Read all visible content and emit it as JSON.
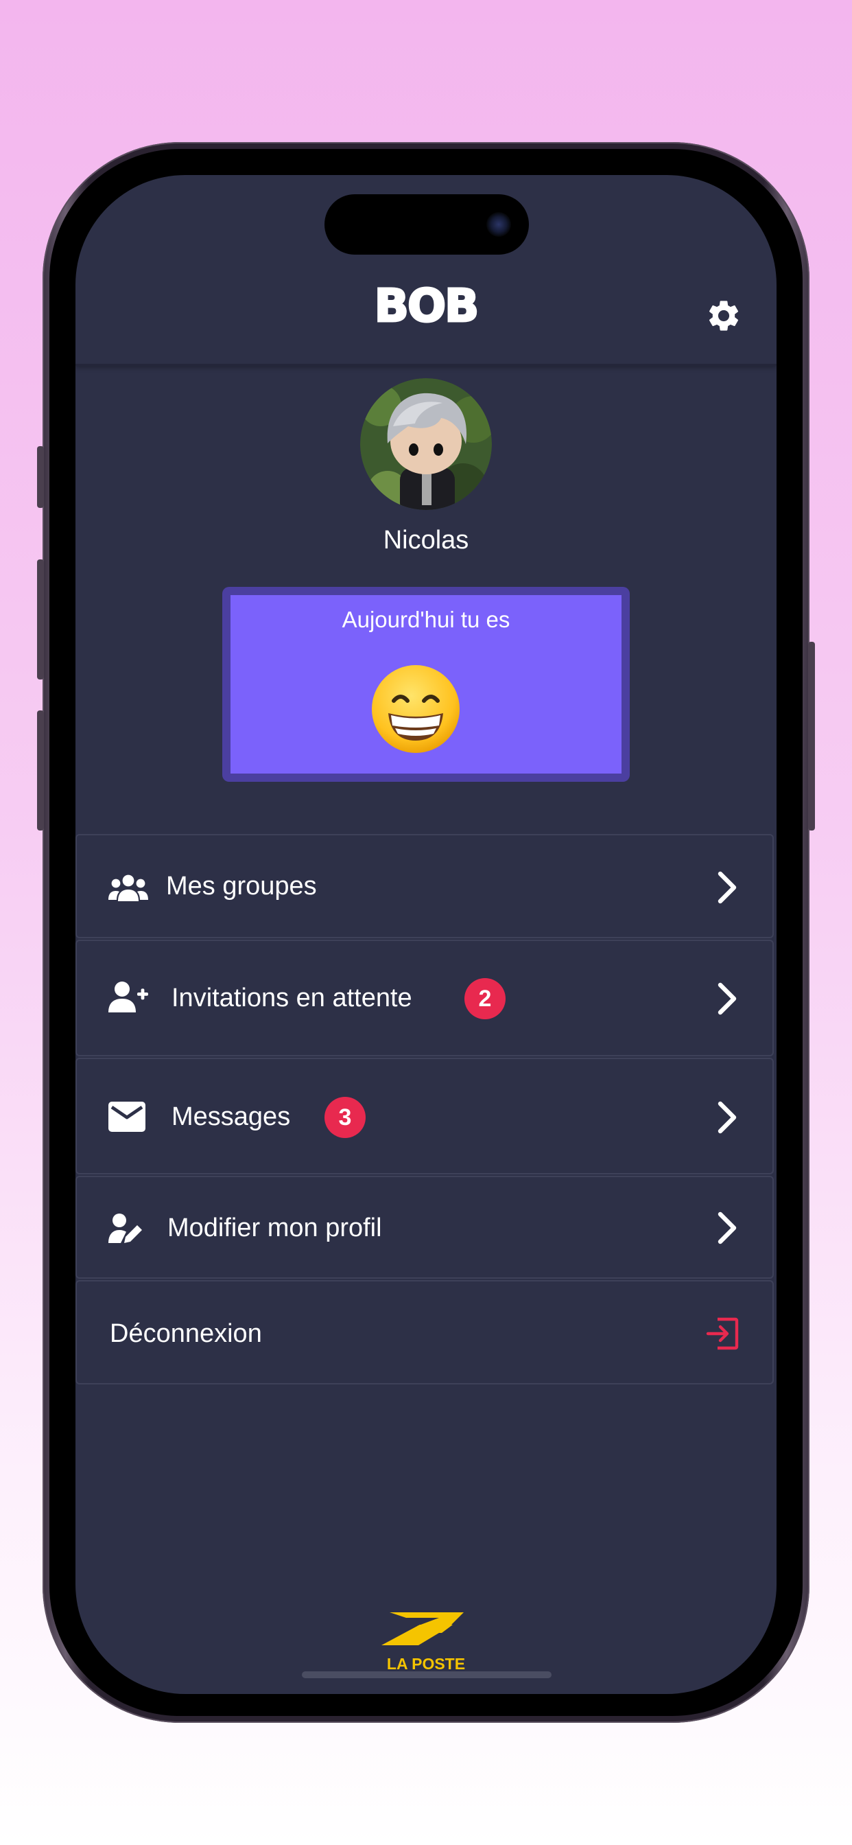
{
  "app": {
    "title": "BOB"
  },
  "header": {
    "settings_icon": "gear-icon"
  },
  "profile": {
    "username": "Nicolas",
    "avatar": "avatar-photo"
  },
  "mood": {
    "title": "Aujourd'hui tu es",
    "emoji": "grinning-face-icon"
  },
  "menu": {
    "items": [
      {
        "label": "Mes groupes",
        "icon": "group-icon"
      },
      {
        "label": "Invitations en attente",
        "icon": "add-user-icon",
        "badge": "2"
      },
      {
        "label": "Messages",
        "icon": "mail-icon",
        "badge": "3"
      },
      {
        "label": "Modifier mon profil",
        "icon": "edit-profile-icon"
      }
    ],
    "logout": {
      "label": "Déconnexion",
      "icon": "logout-icon"
    }
  },
  "footer": {
    "brand": "LA POSTE"
  },
  "colors": {
    "background": "#2d3047",
    "mood_card": "#7b62fb",
    "badge": "#e8294f",
    "logout_icon": "#e8294f",
    "brand_yellow": "#f5c400"
  }
}
